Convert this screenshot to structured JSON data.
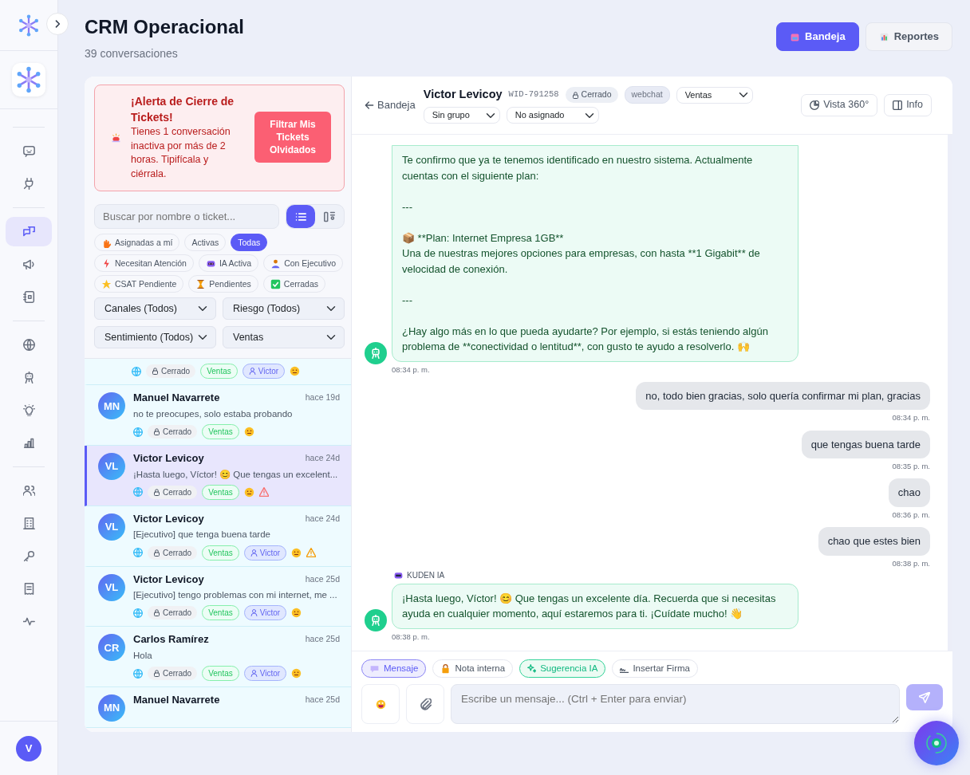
{
  "sidebar": {
    "groups": [
      [
        {
          "selected": false
        },
        {
          "selected": false
        }
      ],
      [
        {
          "selected": true
        },
        {
          "selected": false
        },
        {
          "selected": false
        }
      ],
      [
        {
          "selected": false
        },
        {
          "selected": false
        },
        {
          "selected": false
        },
        {
          "selected": false
        }
      ],
      [
        {
          "selected": false
        },
        {
          "selected": false
        },
        {
          "selected": false
        },
        {
          "selected": false
        },
        {
          "selected": false
        }
      ]
    ],
    "user_initial": "V"
  },
  "header": {
    "title": "CRM Operacional",
    "subtitle": "39 conversaciones",
    "buttons": [
      {
        "label": "Bandeja",
        "selected": true
      },
      {
        "label": "Reportes",
        "selected": false
      }
    ]
  },
  "alert": {
    "title": "¡Alerta de Cierre de Tickets!",
    "text": "Tienes 1 conversación inactiva por más de 2 horas. Tipifícala y ciérrala.",
    "button": "Filtrar Mis Tickets Olvidados"
  },
  "search": {
    "placeholder": "Buscar por nombre o ticket...",
    "views": [
      {
        "selected": true
      },
      {
        "selected": false
      }
    ]
  },
  "filters": [
    {
      "label": "Asignadas a mí",
      "selected": false
    },
    {
      "label": "Activas",
      "selected": false
    },
    {
      "label": "Todas",
      "selected": true
    },
    {
      "label": "Necesitan Atención",
      "selected": false
    },
    {
      "label": "IA Activa",
      "selected": false
    },
    {
      "label": "Con Ejecutivo",
      "selected": false
    },
    {
      "label": "CSAT Pendiente",
      "selected": false
    },
    {
      "label": "Pendientes",
      "selected": false
    },
    {
      "label": "Cerradas",
      "selected": false
    }
  ],
  "dropdowns": [
    "Canales (Todos)",
    "Riesgo (Todos)",
    "Sentimiento (Todos)",
    "Ventas"
  ],
  "conversations": [
    {
      "status": "Cerrado",
      "department": "Ventas",
      "agent": "Victor",
      "selected": false
    },
    {
      "initials": "MN",
      "name": "Manuel Navarrete",
      "time": "hace 19d",
      "preview": "no te preocupes, solo estaba probando",
      "status": "Cerrado",
      "department": "Ventas",
      "selected": false
    },
    {
      "initials": "VL",
      "name": "Victor Levicoy",
      "time": "hace 24d",
      "preview": "¡Hasta luego, Víctor! 😊 Que tengas un excelent...",
      "status": "Cerrado",
      "department": "Ventas",
      "color": "#f87171",
      "selected": true
    },
    {
      "initials": "VL",
      "name": "Victor Levicoy",
      "time": "hace 24d",
      "preview": "[Ejecutivo] que tenga buena tarde",
      "status": "Cerrado",
      "department": "Ventas",
      "agent": "Victor",
      "color": "#f59e0b",
      "selected": false
    },
    {
      "initials": "VL",
      "name": "Victor Levicoy",
      "time": "hace 25d",
      "preview": "[Ejecutivo] tengo problemas con mi internet, me ...",
      "status": "Cerrado",
      "department": "Ventas",
      "agent": "Victor",
      "selected": false
    },
    {
      "initials": "CR",
      "name": "Carlos Ramírez",
      "time": "hace 25d",
      "preview": "Hola",
      "status": "Cerrado",
      "department": "Ventas",
      "agent": "Victor",
      "selected": false
    },
    {
      "initials": "MN",
      "name": "Manuel Navarrete",
      "time": "hace 25d",
      "selected": false
    }
  ],
  "chat": {
    "back": "Bandeja",
    "name": "Victor Levicoy",
    "wid": "WID-791258",
    "status": "Cerrado",
    "channel": "webchat",
    "department": "Ventas",
    "group": "Sin grupo",
    "assignee": "No asignado",
    "buttons": [
      "Vista 360°",
      "Info"
    ],
    "messages": [
      {
        "kind": "bot",
        "text": "Te confirmo que ya te tenemos identificado en nuestro sistema. Actualmente cuentas con el siguiente plan:\n\n---\n\n📦 **Plan: Internet Empresa 1GB**\nUna de nuestras mejores opciones para empresas, con hasta **1 Gigabit** de velocidad de conexión.\n\n---\n\n¿Hay algo más en lo que pueda ayudarte? Por ejemplo, si estás teniendo algún problema de **conectividad o lentitud**, con gusto te ayudo a resolverlo. 🙌",
        "time": "08:34 p. m."
      },
      {
        "kind": "user",
        "text": "no, todo bien gracias, solo quería confirmar mi plan, gracias",
        "time": "08:34 p. m."
      },
      {
        "kind": "user",
        "text": "que tengas buena tarde",
        "time": "08:35 p. m."
      },
      {
        "kind": "user",
        "text": "chao",
        "time": "08:36 p. m."
      },
      {
        "kind": "user",
        "text": "chao que estes bien",
        "time": "08:38 p. m."
      },
      {
        "kind": "bot",
        "sender": "KUDEN IA",
        "text": "¡Hasta luego, Víctor! 😊 Que tengas un excelente día. Recuerda que si necesitas ayuda en cualquier momento, aquí estaremos para ti. ¡Cuídate mucho! 👋",
        "time": "08:38 p. m."
      }
    ],
    "composer": {
      "modes": [
        {
          "label": "Mensaje",
          "kind": "message",
          "selected": true
        },
        {
          "label": "Nota interna",
          "kind": "note",
          "selected": false
        },
        {
          "label": "Sugerencia IA",
          "kind": "ai",
          "selected": false
        },
        {
          "label": "Insertar Firma",
          "kind": "signature",
          "selected": false
        }
      ],
      "placeholder": "Escribe un mensaje... (Ctrl + Enter para enviar)",
      "send_disabled": true
    }
  }
}
